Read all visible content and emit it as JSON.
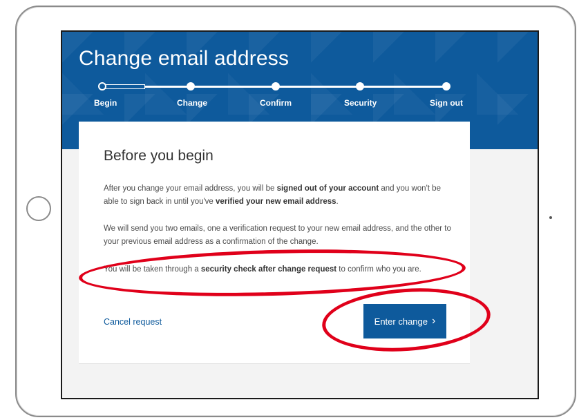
{
  "page": {
    "title": "Change email address"
  },
  "steps": [
    {
      "label": "Begin",
      "state": "current"
    },
    {
      "label": "Change",
      "state": "pending"
    },
    {
      "label": "Confirm",
      "state": "pending"
    },
    {
      "label": "Security",
      "state": "pending"
    },
    {
      "label": "Sign out",
      "state": "pending"
    }
  ],
  "card": {
    "heading": "Before you begin",
    "p1": {
      "t1": "After you change your email address, you will be ",
      "b1": "signed out of your account",
      "t2": " and you won't be able to sign back in until you've ",
      "b2": "verified your new email address",
      "t3": "."
    },
    "p2": "We will send you two emails, one a verification request to your new email address, and the other to your previous email address as a confirmation of the change.",
    "p3": {
      "t1": "You will be taken through a ",
      "b1": "security check after change request",
      "t2": " to confirm who you are."
    },
    "cancel_label": "Cancel request",
    "enter_label": "Enter change",
    "enter_icon": "chevron-right-icon"
  },
  "colors": {
    "brand_blue": "#0e5a9c",
    "annotation_red": "#e0001a"
  }
}
